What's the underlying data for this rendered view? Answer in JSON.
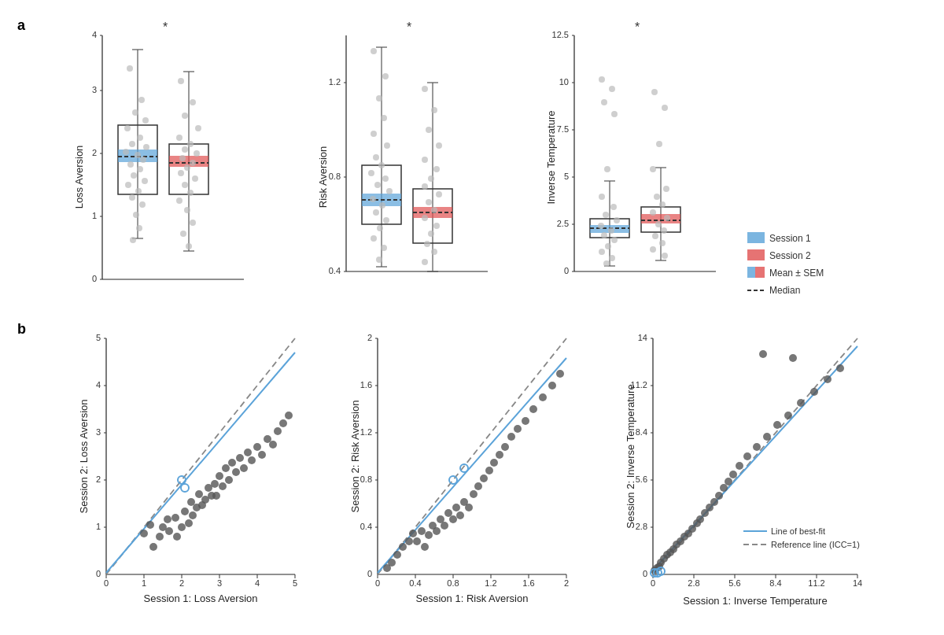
{
  "figure": {
    "panel_a_label": "a",
    "panel_b_label": "b",
    "legend": {
      "session1_label": "Session 1",
      "session2_label": "Session 2",
      "mean_sem_label": "Mean ± SEM",
      "median_label": "Median"
    },
    "plots_a": [
      {
        "id": "loss_aversion_box",
        "ylabel": "Loss Aversion",
        "significance": "*",
        "ymin": 0,
        "ymax": 4,
        "yticks": [
          0,
          1,
          2,
          3,
          4
        ]
      },
      {
        "id": "risk_aversion_box",
        "ylabel": "Risk Aversion",
        "significance": "*",
        "ymin": 0.4,
        "ymax": 1.4,
        "yticks": [
          0.4,
          0.8,
          1.2
        ]
      },
      {
        "id": "inv_temp_box",
        "ylabel": "Inverse Temperature",
        "significance": "*",
        "ymin": 0,
        "ymax": 12.5,
        "yticks": [
          0,
          2.5,
          5,
          7.5,
          10,
          12.5
        ]
      }
    ],
    "plots_b": [
      {
        "id": "loss_aversion_scatter",
        "xlabel": "Session 1: Loss Aversion",
        "ylabel": "Session 2: Loss Aversion",
        "xmin": 0,
        "xmax": 5,
        "ymin": 0,
        "ymax": 5
      },
      {
        "id": "risk_aversion_scatter",
        "xlabel": "Session 1: Risk Aversion",
        "ylabel": "Session 2: Risk Aversion",
        "xmin": 0,
        "xmax": 2,
        "ymin": 0,
        "ymax": 2
      },
      {
        "id": "inv_temp_scatter",
        "xlabel": "Session 1: Inverse Temperature",
        "ylabel": "Session 2: Inverse Temperature",
        "xmin": 0,
        "xmax": 14,
        "ymin": 0,
        "ymax": 14,
        "legend_bestfit": "Line of best-fit",
        "legend_reference": "Reference line (ICC=1)"
      }
    ]
  }
}
